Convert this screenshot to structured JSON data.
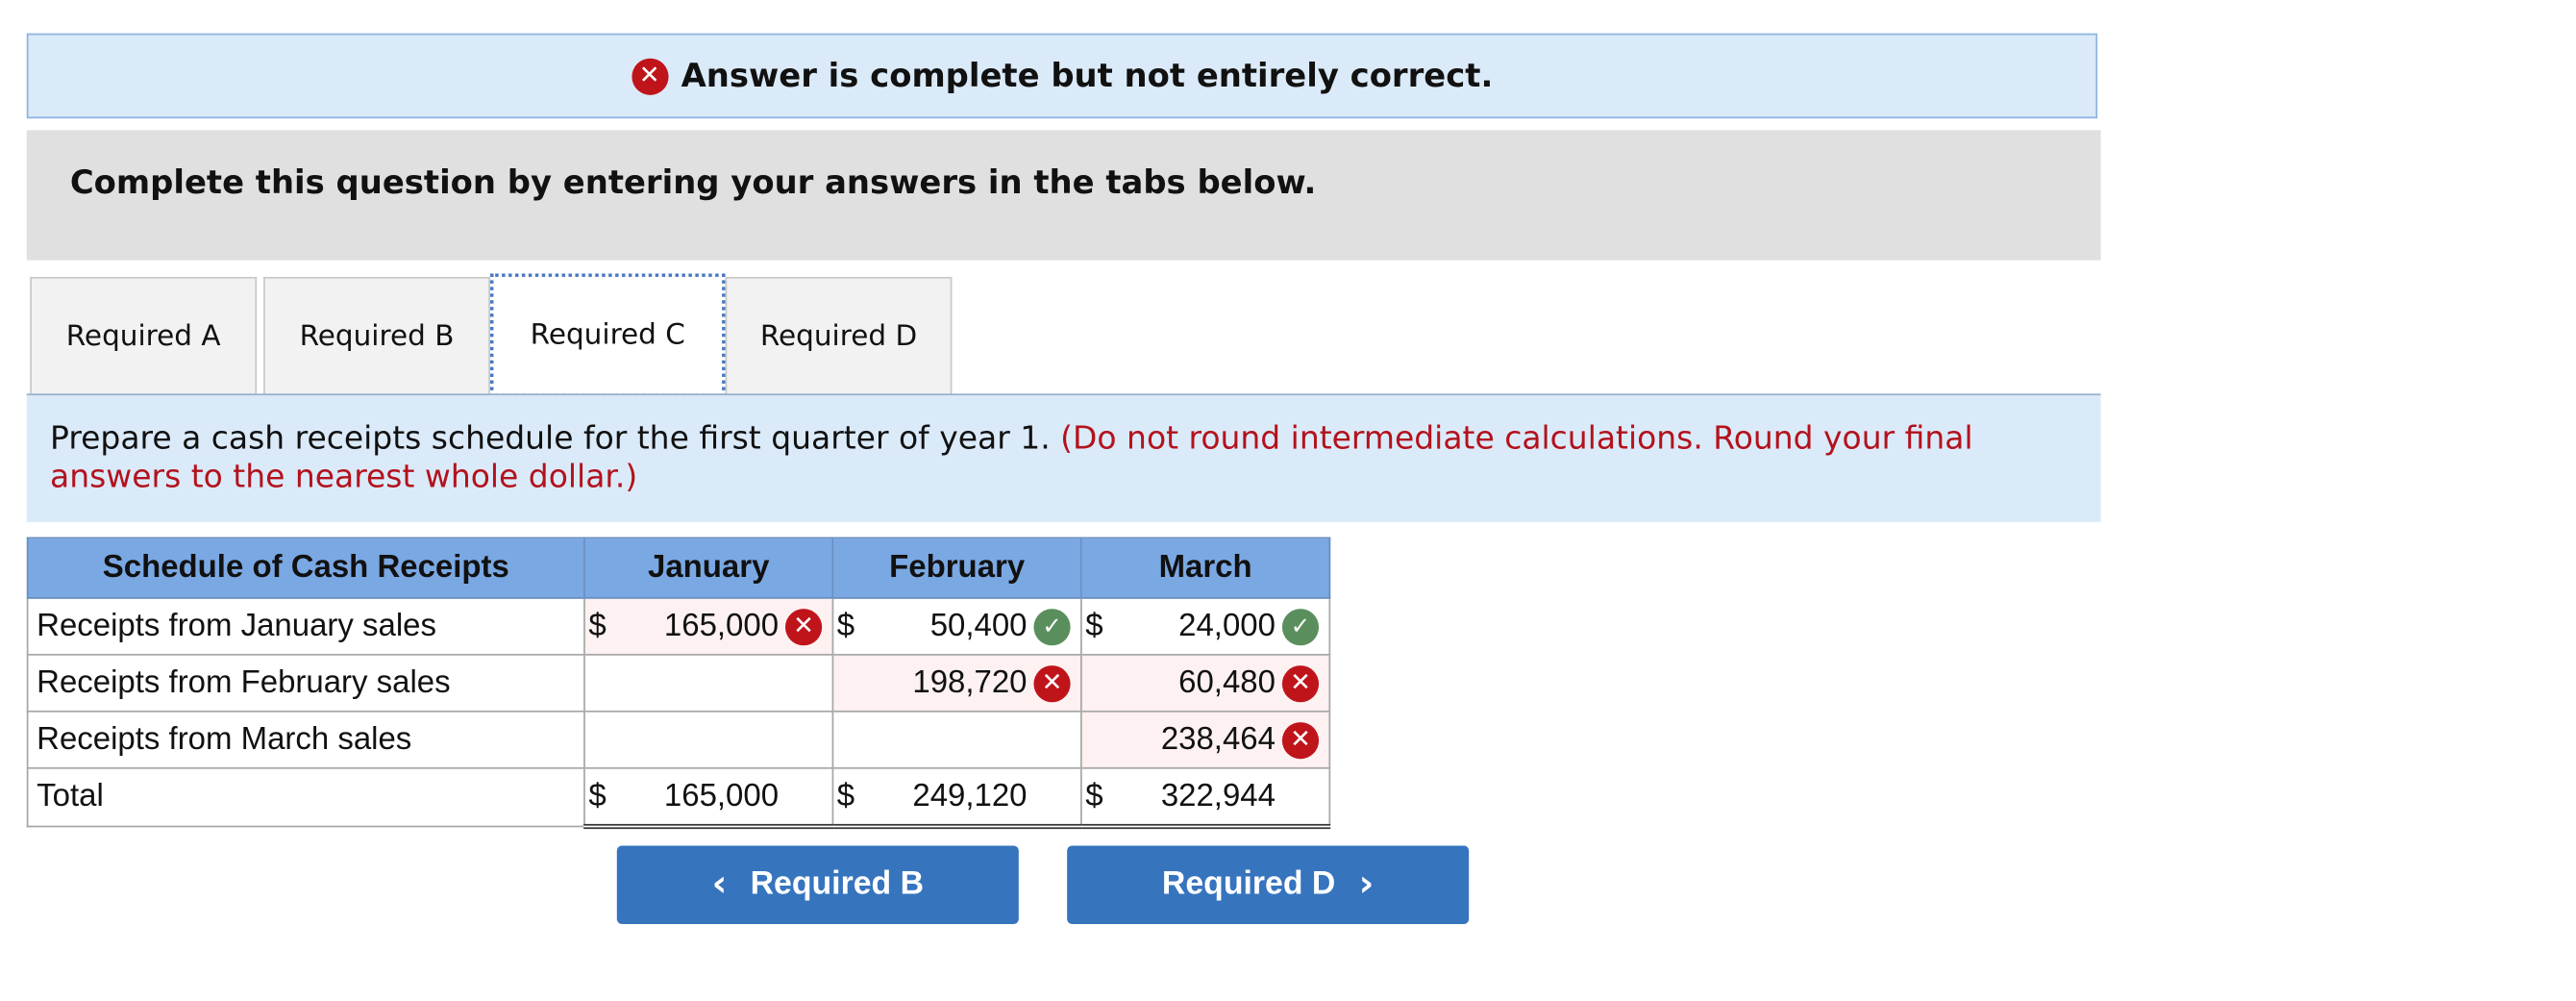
{
  "banner": {
    "icon": "x-circle-icon",
    "text": "Answer is complete but not entirely correct."
  },
  "instruction": "Complete this question by entering your answers in the tabs below.",
  "tabs": [
    {
      "label": "Required A",
      "active": false
    },
    {
      "label": "Required B",
      "active": false
    },
    {
      "label": "Required C",
      "active": true
    },
    {
      "label": "Required D",
      "active": false
    }
  ],
  "prompt": {
    "text": "Prepare a cash receipts schedule for the first quarter of year 1.",
    "note": "(Do not round intermediate calculations. Round your final answers to the nearest whole dollar.)"
  },
  "table": {
    "headers": [
      "Schedule of Cash Receipts",
      "January",
      "February",
      "March"
    ],
    "rows": [
      {
        "label": "Receipts from January sales",
        "cells": [
          {
            "dollar": "$",
            "value": "165,000",
            "status": "wrong"
          },
          {
            "dollar": "$",
            "value": "50,400",
            "status": "correct"
          },
          {
            "dollar": "$",
            "value": "24,000",
            "status": "correct"
          }
        ]
      },
      {
        "label": "Receipts from February sales",
        "cells": [
          {
            "dollar": "",
            "value": "",
            "status": ""
          },
          {
            "dollar": "",
            "value": "198,720",
            "status": "wrong"
          },
          {
            "dollar": "",
            "value": "60,480",
            "status": "wrong"
          }
        ]
      },
      {
        "label": "Receipts from March sales",
        "cells": [
          {
            "dollar": "",
            "value": "",
            "status": ""
          },
          {
            "dollar": "",
            "value": "",
            "status": ""
          },
          {
            "dollar": "",
            "value": "238,464",
            "status": "wrong"
          }
        ]
      },
      {
        "label": "Total",
        "cells": [
          {
            "dollar": "$",
            "value": "165,000",
            "status": ""
          },
          {
            "dollar": "$",
            "value": "249,120",
            "status": ""
          },
          {
            "dollar": "$",
            "value": "322,944",
            "status": ""
          }
        ]
      }
    ]
  },
  "nav": {
    "prev_label": "Required B",
    "next_label": "Required D"
  },
  "colors": {
    "wrong": "#c0141b",
    "correct": "#5a8f5d",
    "header": "#7aa8e3",
    "button": "#3674be"
  }
}
